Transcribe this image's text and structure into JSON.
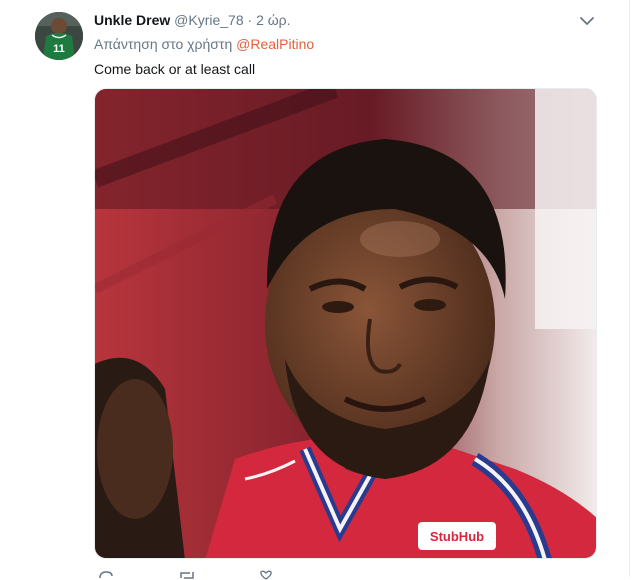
{
  "tweet": {
    "display_name": "Unkle Drew",
    "handle": "@Kyrie_78",
    "separator": "·",
    "time": "2 ώρ.",
    "reply_prefix": "Απάντηση στο χρήστη ",
    "reply_mention": "@RealPitino",
    "text": "Come back or at least call",
    "avatar_jersey_number": "11",
    "media_jersey_sponsor": "StubHub"
  },
  "icons": {
    "more": "chevron-down-icon",
    "reply": "reply-icon",
    "retweet": "retweet-icon",
    "like": "heart-icon"
  },
  "colors": {
    "mention": "#e0613a",
    "jersey_red": "#d3283d",
    "jersey_blue": "#2a3a8f"
  }
}
